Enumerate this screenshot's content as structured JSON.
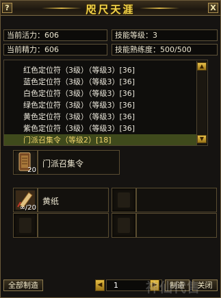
{
  "window": {
    "title": "咫尺天涯",
    "help_label": "?",
    "close_label": "X"
  },
  "stats": {
    "vitality": "当前活力：606",
    "skill_level": "技能等级：3",
    "energy": "当前精力：606",
    "proficiency": "技能熟练度：500/500"
  },
  "recipes": [
    {
      "label": "红色定位符（3级）（等级3）[36]"
    },
    {
      "label": "蓝色定位符（3级）（等级3）[36]"
    },
    {
      "label": "白色定位符（3级）（等级3）[36]"
    },
    {
      "label": "绿色定位符（3级）（等级3）[36]"
    },
    {
      "label": "黄色定位符（3级）（等级3）[36]"
    },
    {
      "label": "紫色定位符（3级）（等级3）[36]"
    },
    {
      "label": "门派召集令（等级2）[18]"
    }
  ],
  "product": {
    "name": "门派召集令",
    "count": "20"
  },
  "materials": [
    {
      "name": "黄纸",
      "count": "∞/20"
    }
  ],
  "bottom": {
    "make_all": "全部制造",
    "page": "1",
    "make": "制造",
    "close": "关闭",
    "prev_icon": "◀",
    "next_icon": "▶"
  },
  "watermark": "神仙代售"
}
